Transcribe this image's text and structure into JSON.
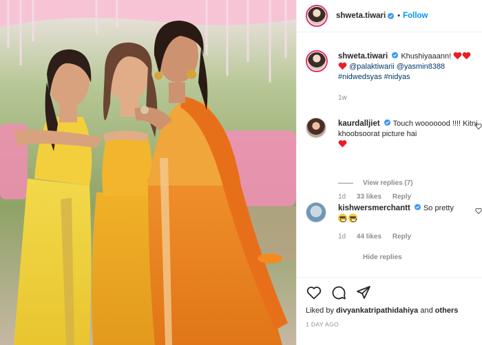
{
  "header": {
    "username": "shweta.tiwari",
    "separator": "•",
    "follow_label": "Follow"
  },
  "caption": {
    "username": "shweta.tiwari",
    "text": "Khushiyaaann!",
    "mentions": "@palaktiwarii @yasmin8388",
    "hashtags": "#nidwedsyas #nidyas",
    "time": "1w"
  },
  "comments": [
    {
      "username": "kaurdalljiet",
      "text": "Touch wooooood !!!! Kitni khoobsoorat picture hai",
      "time": "1d",
      "likes": "33 likes",
      "reply": "Reply",
      "view_replies": "View replies (7)"
    },
    {
      "username": "kishwersmerchantt",
      "text": "So pretty",
      "time": "1d",
      "likes": "44 likes",
      "reply": "Reply",
      "hide_replies": "Hide replies"
    }
  ],
  "footer": {
    "liked_by_prefix": "Liked by",
    "liked_by_user": "divyankatripathidahiya",
    "liked_by_and": "and",
    "liked_by_others": "others",
    "posted_ago": "1 DAY AGO"
  },
  "colors": {
    "accent_blue": "#0095f6",
    "verified_blue": "#3897f0",
    "heart_red": "#ed1c24",
    "link_blue": "#00376b",
    "muted_gray": "#8e8e8e"
  },
  "icons": [
    "verified-icon",
    "heart-icon",
    "comment-icon",
    "share-icon",
    "grin-emoji-icon"
  ]
}
